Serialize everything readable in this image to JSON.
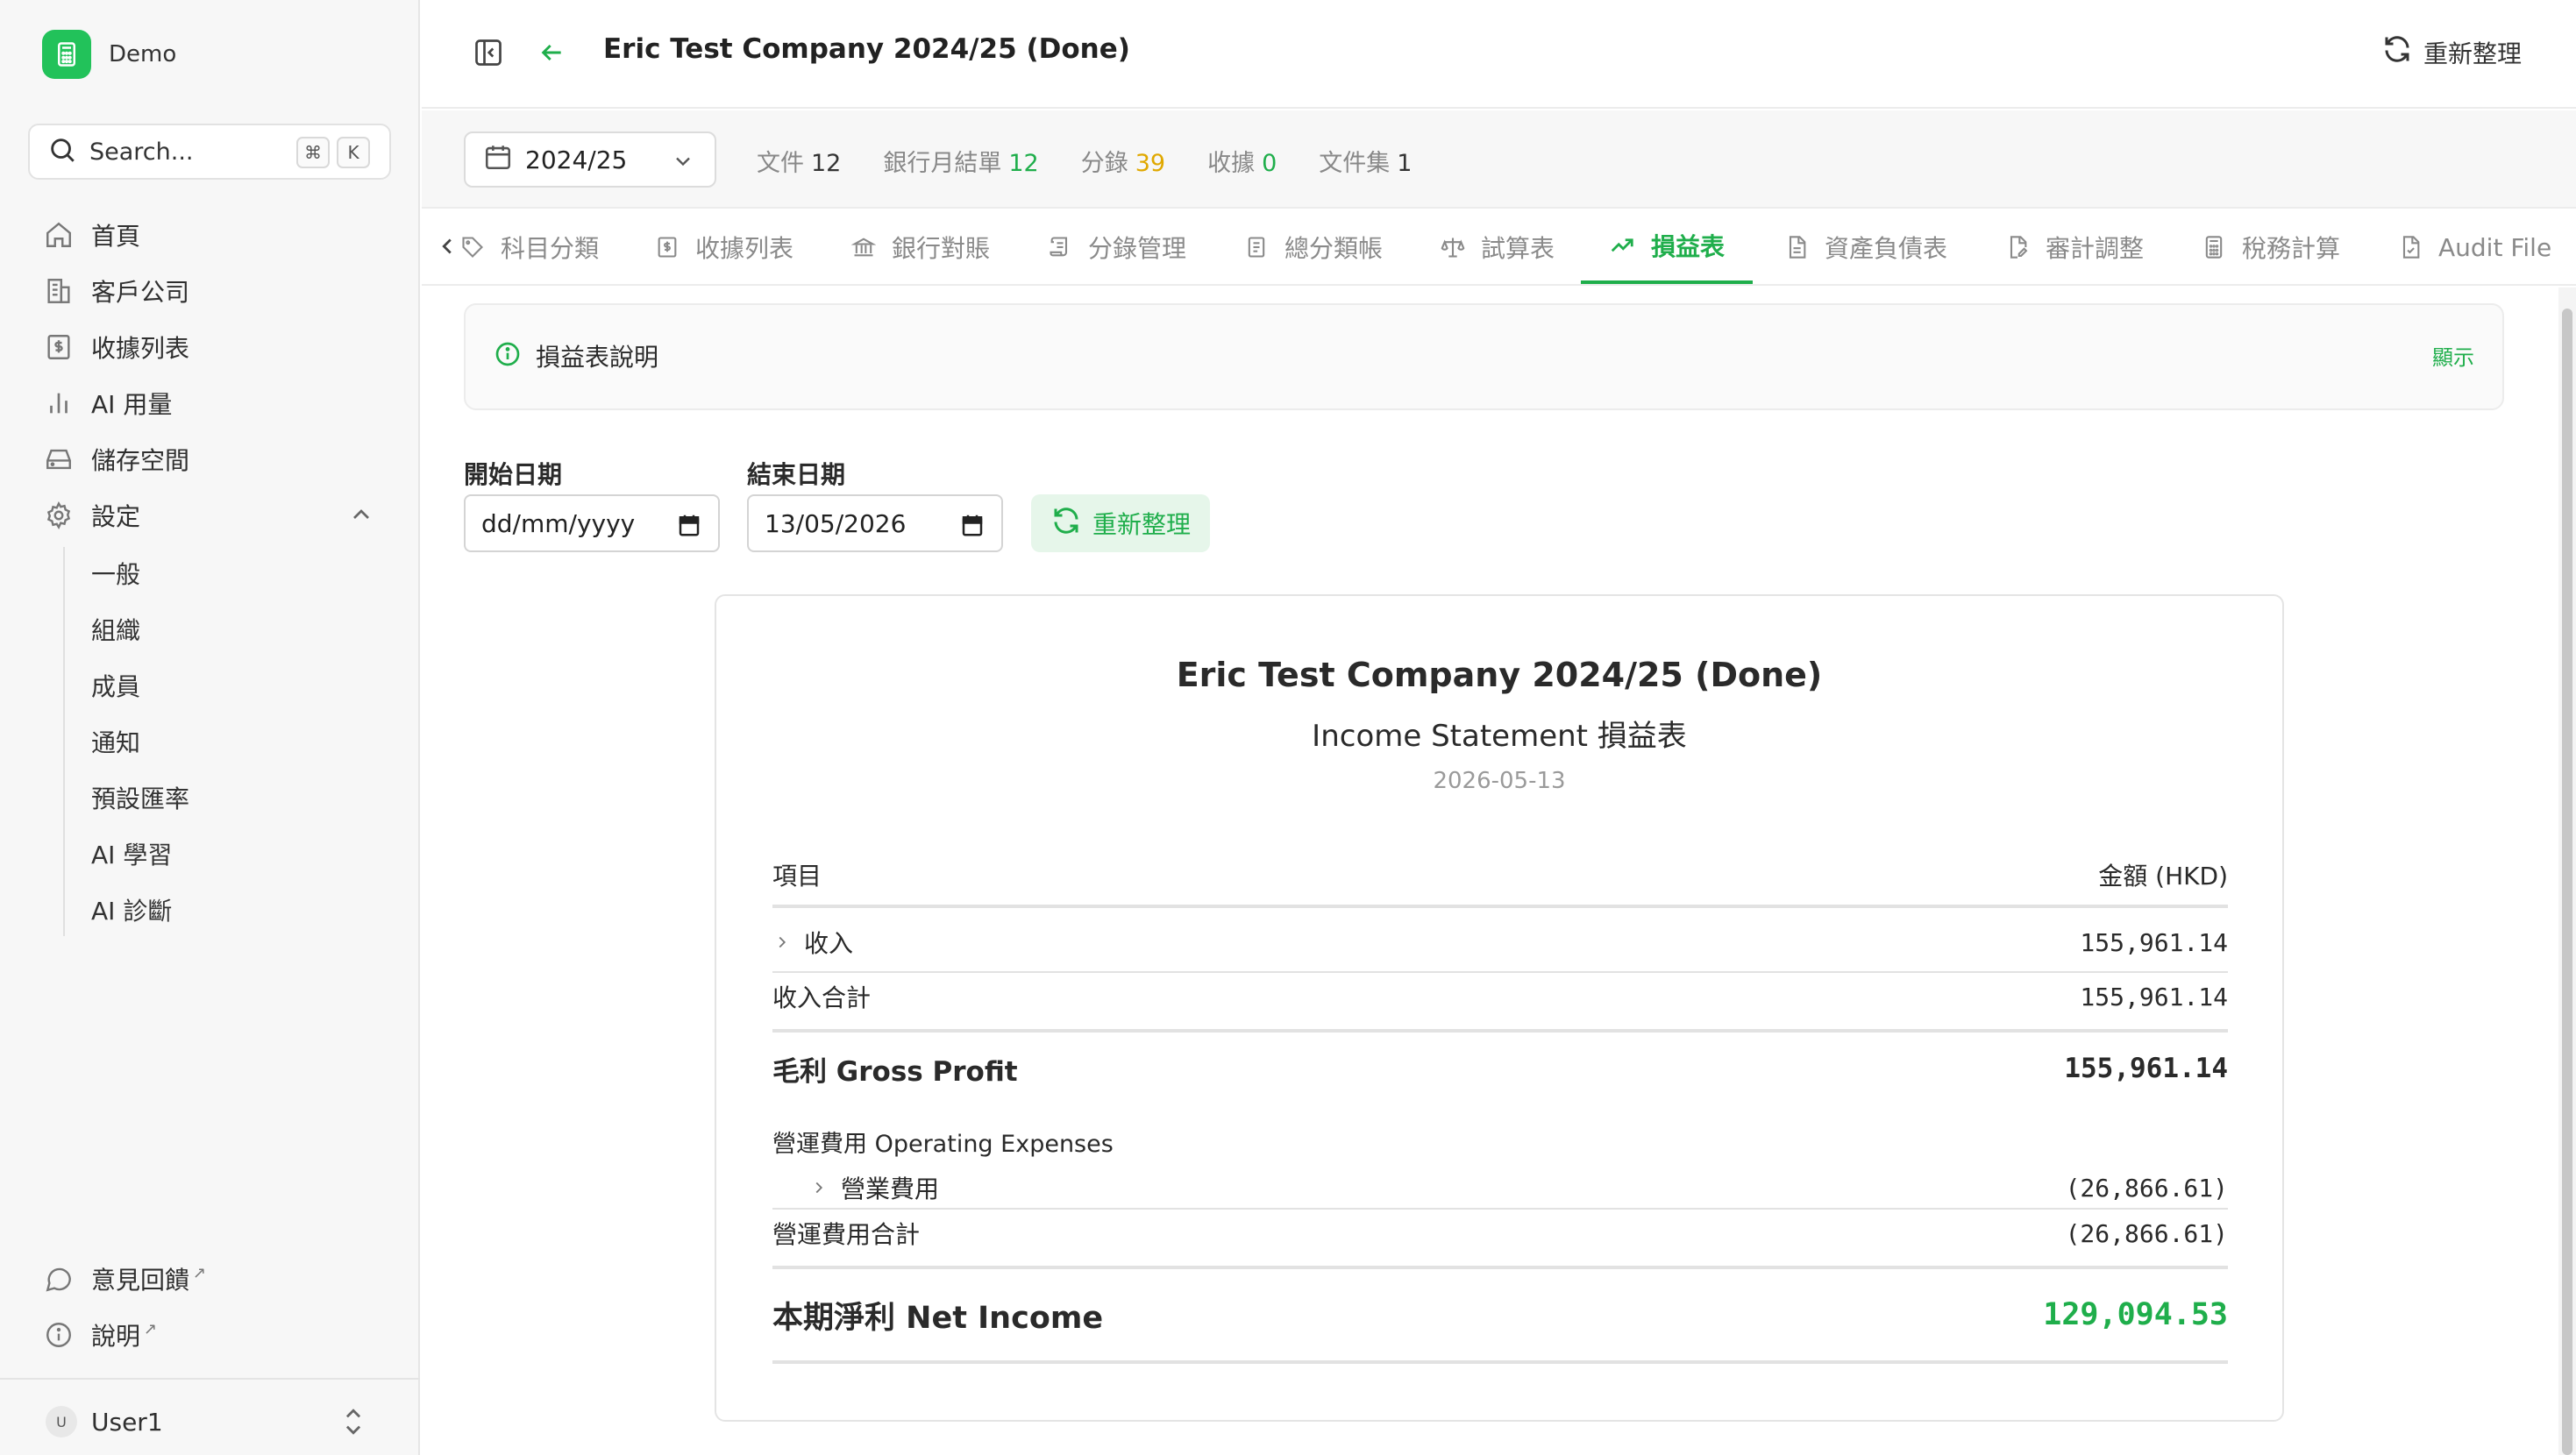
{
  "app": {
    "name": "Demo"
  },
  "search": {
    "label": "Search...",
    "shortcut_cmd": "⌘",
    "shortcut_key": "K"
  },
  "sidebar": {
    "items": [
      {
        "label": "首頁",
        "icon": "home-icon"
      },
      {
        "label": "客戶公司",
        "icon": "building-icon"
      },
      {
        "label": "收據列表",
        "icon": "receipt-icon"
      },
      {
        "label": "AI 用量",
        "icon": "bar-chart-icon"
      },
      {
        "label": "儲存空間",
        "icon": "hard-drive-icon"
      },
      {
        "label": "設定",
        "icon": "gear-icon"
      }
    ],
    "settings_sub": [
      "一般",
      "組織",
      "成員",
      "通知",
      "預設匯率",
      "AI 學習",
      "AI 診斷"
    ],
    "feedback": "意見回饋",
    "help": "說明",
    "user_initial": "U",
    "user_name": "User1"
  },
  "header": {
    "title": "Eric Test Company 2024/25 (Done)",
    "refresh_label": "重新整理"
  },
  "stats": {
    "year": "2024/25",
    "documents_label": "文件",
    "documents": "12",
    "bank_label": "銀行月結單",
    "bank": "12",
    "entries_label": "分錄",
    "entries": "39",
    "receipts_label": "收據",
    "receipts": "0",
    "collections_label": "文件集",
    "collections": "1"
  },
  "tabs": [
    {
      "label": "科目分類"
    },
    {
      "label": "收據列表"
    },
    {
      "label": "銀行對賬"
    },
    {
      "label": "分錄管理"
    },
    {
      "label": "總分類帳"
    },
    {
      "label": "試算表"
    },
    {
      "label": "損益表"
    },
    {
      "label": "資產負債表"
    },
    {
      "label": "審計調整"
    },
    {
      "label": "稅務計算"
    },
    {
      "label": "Audit File"
    }
  ],
  "info": {
    "label": "損益表說明",
    "toggle": "顯示"
  },
  "filters": {
    "start_label": "開始日期",
    "start_placeholder": "dd/mm/yyyy",
    "end_label": "結束日期",
    "end_value": "13/05/2026",
    "refresh_label": "重新整理"
  },
  "report": {
    "company": "Eric Test Company 2024/25 (Done)",
    "title": "Income Statement 損益表",
    "date": "2026-05-13",
    "col_item": "項目",
    "col_amount": "金額 (HKD)",
    "revenue_label": "收入",
    "revenue_value": "155,961.14",
    "revenue_total_label": "收入合計",
    "revenue_total_value": "155,961.14",
    "gross_profit_label": "毛利 Gross Profit",
    "gross_profit_value": "155,961.14",
    "opex_header": "營運費用 Operating Expenses",
    "opex_item_label": "營業費用",
    "opex_item_value": "(26,866.61)",
    "opex_total_label": "營運費用合計",
    "opex_total_value": "(26,866.61)",
    "net_income_label": "本期淨利 Net Income",
    "net_income_value": "129,094.53"
  }
}
